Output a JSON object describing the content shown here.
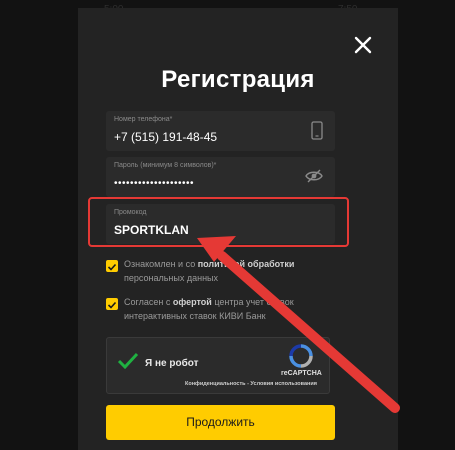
{
  "background": {
    "times": [
      "5:00",
      "7:50"
    ]
  },
  "modal": {
    "title": "Регистрация",
    "phone": {
      "label": "Номер телефона*",
      "value": "+7 (515) 191-48-45",
      "icon": "phone-icon"
    },
    "password": {
      "label": "Пароль (минимум 8 символов)*",
      "value": "••••••••••••••••••••",
      "icon": "eye-off-icon"
    },
    "promo": {
      "label": "Промокод",
      "value": "SPORTKLAN"
    },
    "checkboxes": [
      {
        "text_before": "Ознакомлен и со",
        "link": "политикой обработки",
        "text_after": "персональных данных",
        "checked": true
      },
      {
        "text_before": "Согласен с",
        "link": "офертой",
        "text_after": "центра учет",
        "link2": "ставок",
        "text_line2": "интерактивных ставок КИВИ Банк",
        "checked": true
      }
    ],
    "captcha": {
      "label": "Я не робот",
      "brand": "reCAPTCHA",
      "terms": "Конфиденциальность - Условия использования"
    },
    "submit_label": "Продолжить"
  },
  "colors": {
    "accent": "#ffcc00",
    "annotation": "#e53935",
    "modal_bg": "#232323",
    "check_green": "#1fb141"
  }
}
